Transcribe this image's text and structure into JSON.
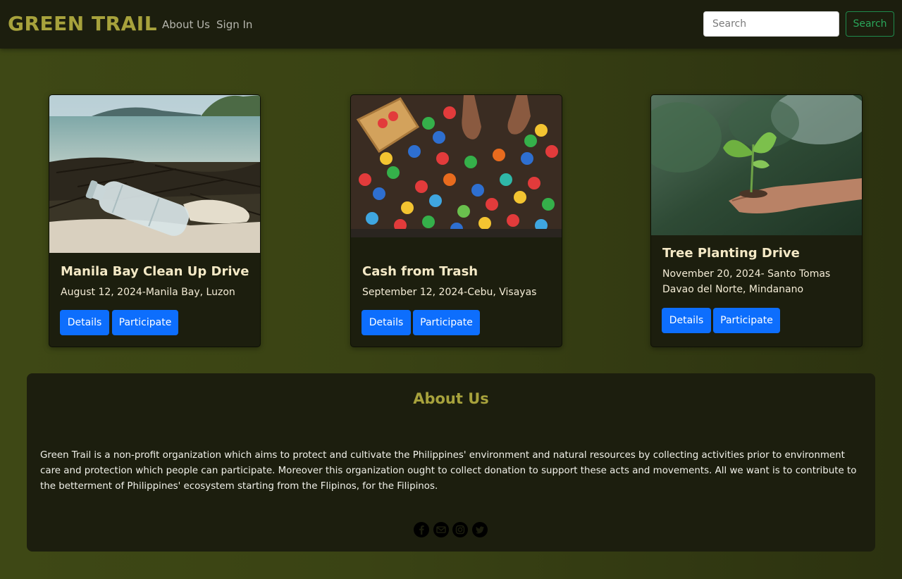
{
  "navbar": {
    "brand": "GREEN TRAIL",
    "links": [
      {
        "label": "About Us"
      },
      {
        "label": "Sign In"
      }
    ],
    "search": {
      "placeholder": "Search",
      "value": "",
      "button_label": "Search"
    }
  },
  "cards": [
    {
      "title": "Manila Bay Clean Up Drive",
      "lines": [
        "August 12, 2024-Manila Bay, Luzon"
      ],
      "details_label": "Details",
      "participate_label": "Participate"
    },
    {
      "title": "Cash from Trash",
      "lines": [
        "September 12, 2024-Cebu, Visayas"
      ],
      "details_label": "Details",
      "participate_label": "Participate"
    },
    {
      "title": "Tree Planting Drive",
      "lines": [
        "November 20, 2024- Santo Tomas",
        "Davao del Norte, Mindanano"
      ],
      "details_label": "Details",
      "participate_label": "Participate"
    }
  ],
  "about": {
    "title": "About Us",
    "text": "Green Trail is a non-profit organization which aims to protect and cultivate the Philippines' environment and natural resources by collecting activities prior to environment care and protection which people can participate. Moreover this organization ought to collect donation to support these acts and movements. All we want is to contribute to the betterment of Philippines' ecosystem starting from the Flipinos, for the Filipinos.",
    "social_icons": [
      "facebook-icon",
      "email-icon",
      "instagram-icon",
      "twitter-icon"
    ]
  },
  "colors": {
    "brand": "#a7a23c",
    "primary_button": "#0d6efd",
    "search_button": "#2aa75b",
    "panel": "#1c1e0e"
  }
}
